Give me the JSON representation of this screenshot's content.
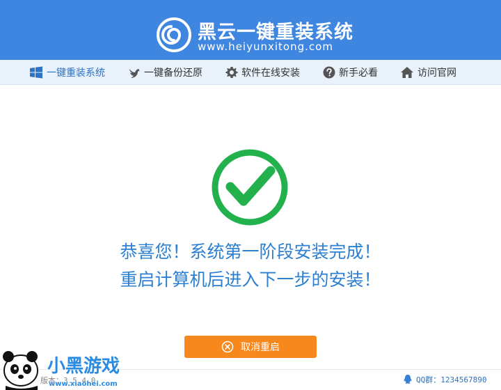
{
  "header": {
    "title": "黑云一键重装系统",
    "url": "www.heiyunxitong.com"
  },
  "nav": {
    "items": [
      {
        "label": "一键重装系统",
        "icon": "windows-icon",
        "active": true
      },
      {
        "label": "一键备份还原",
        "icon": "bird-icon",
        "active": false
      },
      {
        "label": "软件在线安装",
        "icon": "gear-icon",
        "active": false
      },
      {
        "label": "新手必看",
        "icon": "help-icon",
        "active": false
      },
      {
        "label": "访问官网",
        "icon": "home-icon",
        "active": false
      }
    ]
  },
  "main": {
    "line1": "恭喜您！系统第一阶段安装完成！",
    "line2": "重启计算机后进入下一步的安装！",
    "cancel_label": "取消重启"
  },
  "footer": {
    "version": "版本：3.5.4.0",
    "qq": "QQ群：1234567890"
  },
  "watermark": {
    "brand": "小黑游戏",
    "url": "www.xiaohei.com"
  },
  "colors": {
    "header": "#3f86e0",
    "accent": "#2c7fd1",
    "success": "#22b14c",
    "button": "#f7881e"
  }
}
